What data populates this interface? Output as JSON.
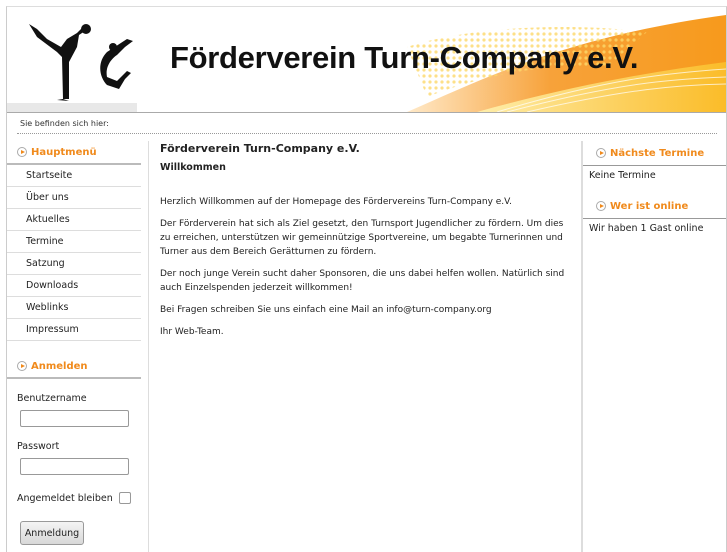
{
  "header": {
    "title": "Förderverein Turn-Company e.V.",
    "accent_color": "#f08a1c"
  },
  "breadcrumb": {
    "label": "Sie befinden sich hier:"
  },
  "main_menu": {
    "title": "Hauptmenü",
    "items": [
      {
        "label": "Startseite"
      },
      {
        "label": "Über uns"
      },
      {
        "label": "Aktuelles"
      },
      {
        "label": "Termine"
      },
      {
        "label": "Satzung"
      },
      {
        "label": "Downloads"
      },
      {
        "label": "Weblinks"
      },
      {
        "label": "Impressum"
      }
    ]
  },
  "login": {
    "title": "Anmelden",
    "username_label": "Benutzername",
    "username_value": "",
    "password_label": "Passwort",
    "password_value": "",
    "remember_label": "Angemeldet bleiben",
    "remember_checked": false,
    "submit_label": "Anmeldung"
  },
  "article": {
    "title": "Förderverein Turn-Company e.V.",
    "subtitle": "Willkommen",
    "paragraphs": [
      "Herzlich Willkommen auf der Homepage des Fördervereins Turn-Company e.V.",
      "Der Förderverein hat sich als Ziel gesetzt, den Turnsport Jugendlicher zu fördern. Um dies zu erreichen, unterstützen wir gemeinnützige Sportvereine, um begabte Turnerinnen und Turner aus dem Bereich Gerätturnen zu fördern.",
      "Der noch junge Verein sucht daher Sponsoren, die uns dabei helfen wollen. Natürlich sind auch Einzelspenden jederzeit willkommen!",
      "Bei Fragen schreiben Sie uns einfach eine Mail an info@turn-company.org",
      "Ihr Web-Team."
    ]
  },
  "sidebar_right": {
    "events": {
      "title": "Nächste Termine",
      "content": "Keine Termine"
    },
    "online": {
      "title": "Wer ist online",
      "content": "Wir haben 1 Gast online"
    }
  }
}
